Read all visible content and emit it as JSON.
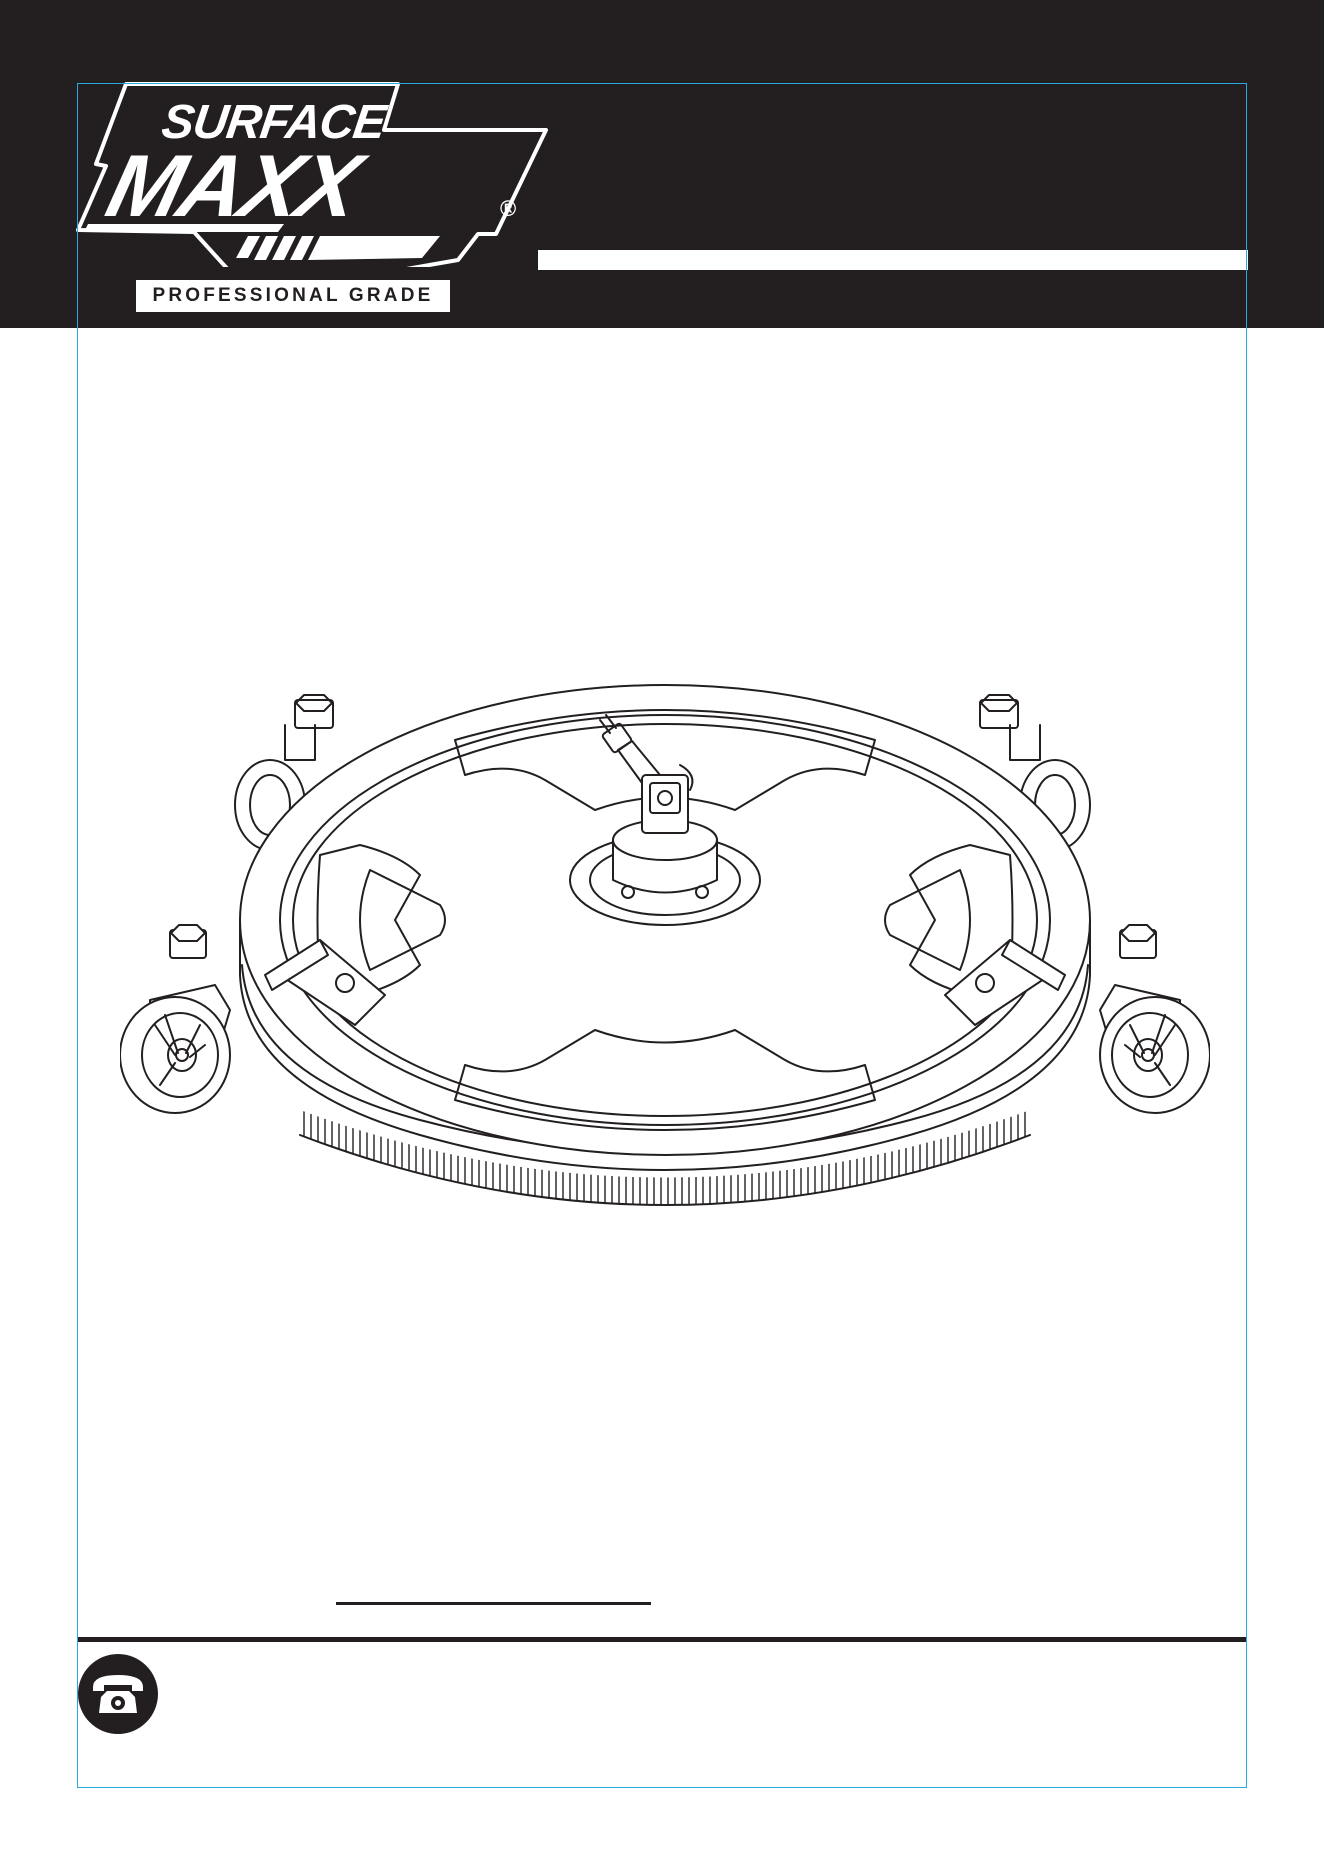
{
  "brand": {
    "line1": "SURFACE",
    "line2": "MAXX",
    "registered_mark": "®",
    "tagline": "PROFESSIONAL GRADE"
  },
  "colors": {
    "header_band": "#231f20",
    "frame": "#29a9e0",
    "ink": "#231f20",
    "paper": "#ffffff"
  },
  "icons": {
    "product": "surface-cleaner-illustration",
    "support": "telephone-icon"
  }
}
